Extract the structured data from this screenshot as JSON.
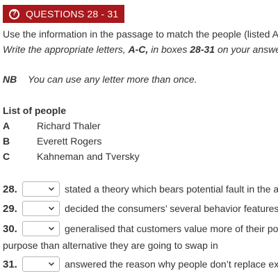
{
  "header": {
    "title": "QUESTIONS 28 - 31"
  },
  "instructions": {
    "line1": "Use the information in the passage to match the people (listed A",
    "line2_pre": "Write the appropriate letters, ",
    "line2_bold": "A-C,",
    "line2_mid": " in boxes ",
    "line2_bold2": "28-31",
    "line2_post": " on your answe"
  },
  "note": {
    "label": "NB",
    "text": "You can use any letter more than once."
  },
  "people": {
    "heading": "List of people",
    "items": [
      {
        "letter": "A",
        "name": "Richard Thaler"
      },
      {
        "letter": "B",
        "name": "Everett Rogers"
      },
      {
        "letter": "C",
        "name": "Kahneman and Tversky"
      }
    ]
  },
  "questions": [
    {
      "number": "28.",
      "selected": "",
      "text": "stated a theory which bears potential fault in the a"
    },
    {
      "number": "29.",
      "selected": "",
      "text": "decided the consumers’ several behavior features"
    },
    {
      "number": "30.",
      "selected": "",
      "text": "generalised that customers value more of their po",
      "continuation": "purpose than alternative they are going to swap in"
    },
    {
      "number": "31.",
      "selected": "",
      "text": "answered the reason why people don’t replace ex"
    }
  ],
  "colors": {
    "header_bg": "#a8181c",
    "text": "#333333"
  },
  "icons": {
    "header": "question-circle-icon",
    "select": "chevron-down-icon"
  }
}
